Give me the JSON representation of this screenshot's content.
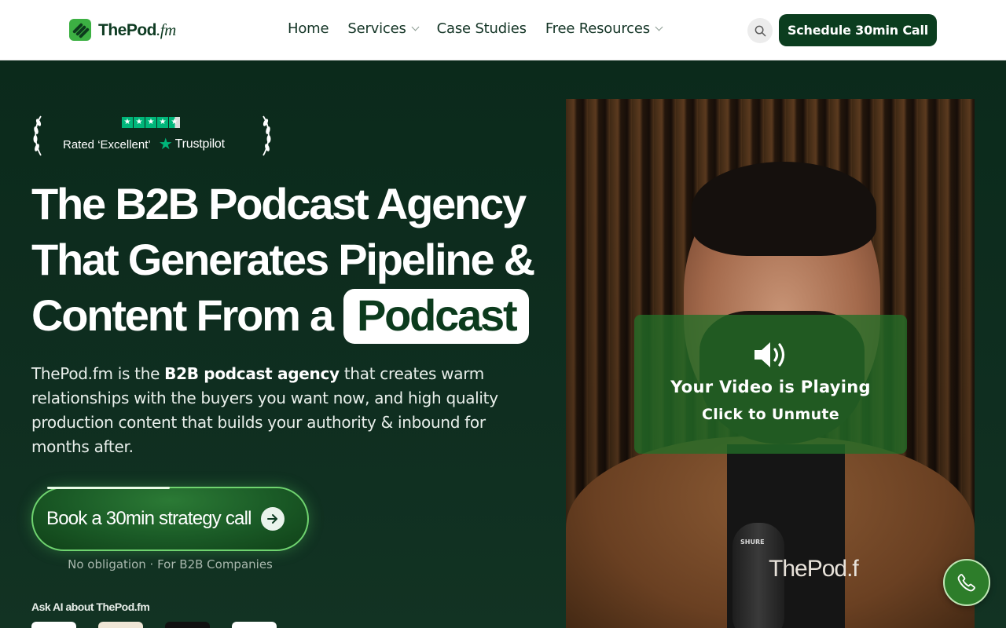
{
  "brand": {
    "name": "ThePod",
    "suffix": ".fm",
    "accent": "#0b3d1f",
    "green": "#3cb043"
  },
  "nav": {
    "items": [
      {
        "label": "Home",
        "has_dropdown": false
      },
      {
        "label": "Services",
        "has_dropdown": true
      },
      {
        "label": "Case Studies",
        "has_dropdown": false
      },
      {
        "label": "Free Resources",
        "has_dropdown": true
      }
    ],
    "search_icon": "search-icon",
    "cta_label": "Schedule 30min Call"
  },
  "rating": {
    "stars": 4.5,
    "text": "Rated ‘Excellent’",
    "provider": "Trustpilot"
  },
  "hero": {
    "headline_lines": [
      "The B2B Podcast Agency",
      "That Generates Pipeline &",
      "Content From a"
    ],
    "headline_highlight": "Podcast",
    "sub_before": "ThePod.fm is the ",
    "sub_bold": "B2B podcast agency",
    "sub_after": " that creates warm relationships with the buyers you want now, and high quality production content that builds your authority & inbound for months after.",
    "cta_label": "Book a 30min strategy call",
    "cta_note": "No obligation · For B2B Companies",
    "ask_ai_label": "Ask AI about ThePod.fm"
  },
  "video": {
    "overlay_title": "Your Video is Playing",
    "overlay_sub": "Click to Unmute",
    "mic_text": "SHURE",
    "shirt_text": "ThePod.f"
  },
  "floating": {
    "phone_icon": "phone-icon"
  }
}
